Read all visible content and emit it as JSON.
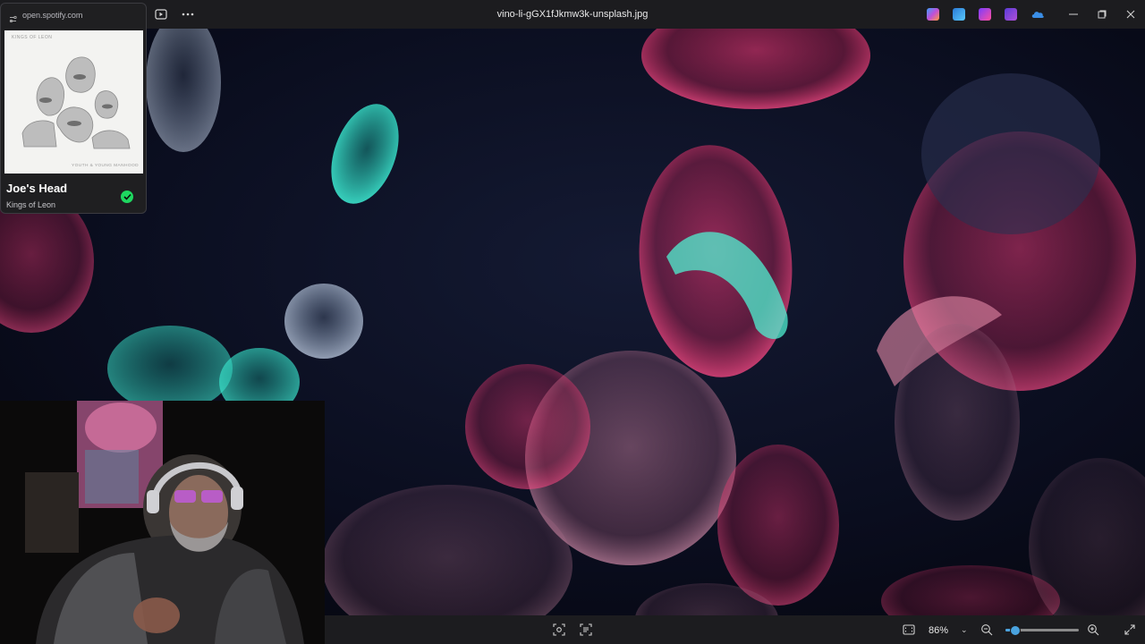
{
  "titlebar": {
    "filename": "vino-li-gGX1fJkmw3k-unsplash.jpg",
    "slideshow_icon": "slideshow-icon",
    "more_icon": "more-options-icon",
    "app_icons": [
      "copilot-icon",
      "edit-icon",
      "clipchamp-icon",
      "designer-icon",
      "onedrive-icon"
    ],
    "window_controls": [
      "minimize-icon",
      "restore-icon",
      "close-icon"
    ]
  },
  "spotify": {
    "url": "open.spotify.com",
    "album_top_text": "KINGS OF LEON",
    "album_bottom_text": "YOUTH & YOUNG MANHOOD",
    "track_title": "Joe's Head",
    "artist": "Kings of Leon",
    "saved_icon": "check-circle-icon",
    "accent": "#1ed760"
  },
  "bottombar": {
    "zoom_value": "86%",
    "zoom_fraction": 0.12,
    "icons": [
      "fit-to-window-icon",
      "visual-search-icon",
      "extract-text-icon",
      "zoom-out-icon",
      "zoom-in-icon",
      "fullscreen-icon"
    ],
    "accent": "#4aa3df"
  }
}
